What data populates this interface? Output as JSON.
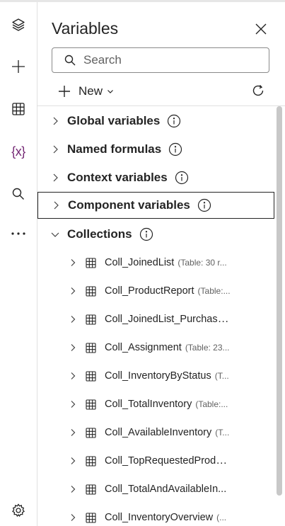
{
  "panel": {
    "title": "Variables",
    "search_placeholder": "Search",
    "new_label": "New",
    "sections": [
      {
        "label": "Global variables"
      },
      {
        "label": "Named formulas"
      },
      {
        "label": "Context variables"
      },
      {
        "label": "Component variables"
      },
      {
        "label": "Collections"
      }
    ],
    "collections": [
      {
        "name": "Coll_JoinedList",
        "meta": "(Table: 30 r..."
      },
      {
        "name": "Coll_ProductReport",
        "meta": "(Table:..."
      },
      {
        "name": "Coll_JoinedList_Purchase...",
        "meta": ""
      },
      {
        "name": "Coll_Assignment",
        "meta": "(Table: 23..."
      },
      {
        "name": "Coll_InventoryByStatus",
        "meta": "(T..."
      },
      {
        "name": "Coll_TotalInventory",
        "meta": "(Table:..."
      },
      {
        "name": "Coll_AvailableInventory",
        "meta": "(T..."
      },
      {
        "name": "Coll_TopRequestedProdu...",
        "meta": ""
      },
      {
        "name": "Coll_TotalAndAvailableIn...",
        "meta": ""
      },
      {
        "name": "Coll_InventoryOverview",
        "meta": "(..."
      }
    ]
  },
  "rail": {
    "items": [
      "layers-icon",
      "plus-icon",
      "table-icon",
      "variables-icon",
      "search-icon",
      "more-icon",
      "settings-icon"
    ],
    "variables_glyph": "{x}",
    "more_glyph": "···"
  },
  "colors": {
    "accent": "#742774",
    "text": "#242424",
    "muted": "#616161"
  }
}
